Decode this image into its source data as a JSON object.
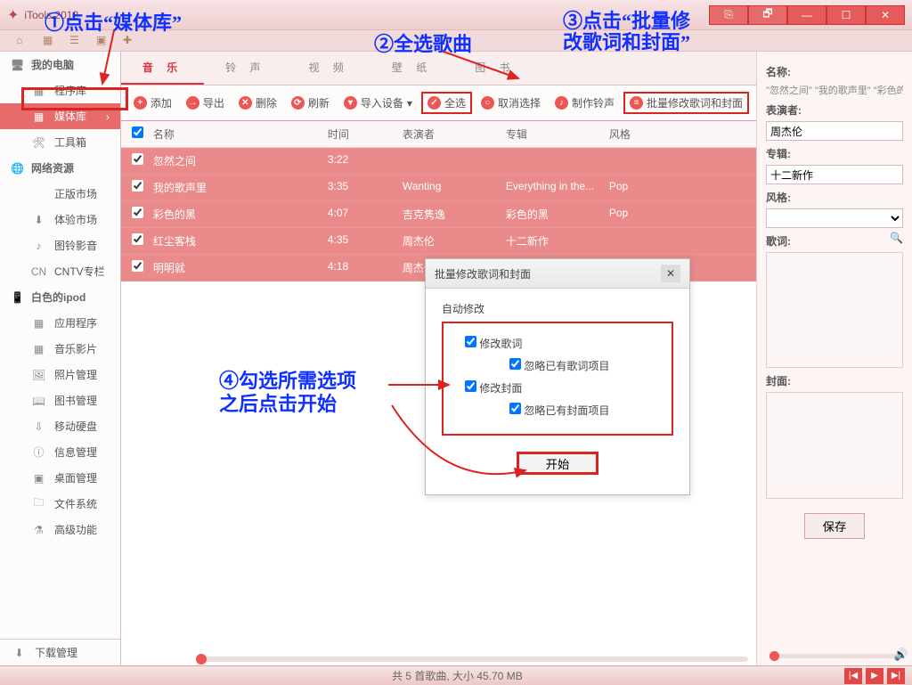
{
  "app": {
    "title": "iTools 2012"
  },
  "window_buttons": {
    "feedback": "⎘",
    "restore": "🗗",
    "min": "—",
    "max": "☐",
    "close": "✕"
  },
  "sidebar": {
    "sections": [
      {
        "title": "我的电脑",
        "icon": "🖥",
        "items": [
          {
            "icon": "▦",
            "label": "程序库"
          },
          {
            "icon": "▦",
            "label": "媒体库",
            "active": true
          },
          {
            "icon": "🛠",
            "label": "工具箱"
          }
        ]
      },
      {
        "title": "网络资源",
        "icon": "🌐",
        "items": [
          {
            "icon": "",
            "label": "正版市场"
          },
          {
            "icon": "⬇",
            "label": "体验市场"
          },
          {
            "icon": "♪",
            "label": "图铃影音"
          },
          {
            "icon": "CN",
            "label": "CNTV专栏"
          }
        ]
      },
      {
        "title": "白色的ipod",
        "icon": "📱",
        "items": [
          {
            "icon": "▦",
            "label": "应用程序"
          },
          {
            "icon": "▦",
            "label": "音乐影片"
          },
          {
            "icon": "🖼",
            "label": "照片管理"
          },
          {
            "icon": "📖",
            "label": "图书管理"
          },
          {
            "icon": "⇩",
            "label": "移动硬盘"
          },
          {
            "icon": "ⓘ",
            "label": "信息管理"
          },
          {
            "icon": "▣",
            "label": "桌面管理"
          },
          {
            "icon": "🗀",
            "label": "文件系统"
          },
          {
            "icon": "⚗",
            "label": "高级功能"
          }
        ]
      }
    ],
    "download_mgr": "下载管理"
  },
  "tabs": [
    "音 乐",
    "铃 声",
    "视 频",
    "壁 纸",
    "图 书"
  ],
  "active_tab": 0,
  "toolbar": {
    "add": "添加",
    "export": "导出",
    "delete": "删除",
    "refresh": "刷新",
    "import_device": "导入设备",
    "select_all": "全选",
    "deselect": "取消选择",
    "make_ring": "制作铃声",
    "batch": "批量修改歌词和封面"
  },
  "columns": {
    "name": "名称",
    "time": "时间",
    "artist": "表演者",
    "album": "专辑",
    "genre": "风格"
  },
  "rows": [
    {
      "name": "忽然之间",
      "time": "3:22",
      "artist": "",
      "album": "",
      "genre": ""
    },
    {
      "name": "我的歌声里",
      "time": "3:35",
      "artist": "Wanting",
      "album": "Everything in the...",
      "genre": "Pop"
    },
    {
      "name": "彩色的黑",
      "time": "4:07",
      "artist": "吉克隽逸",
      "album": "彩色的黑",
      "genre": "Pop"
    },
    {
      "name": "红尘客栈",
      "time": "4:35",
      "artist": "周杰伦",
      "album": "十二新作",
      "genre": ""
    },
    {
      "name": "明明就",
      "time": "4:18",
      "artist": "周杰伦",
      "album": "十二新作",
      "genre": ""
    }
  ],
  "dialog": {
    "title": "批量修改歌词和封面",
    "auto": "自动修改",
    "opt_lyric": "修改歌词",
    "opt_lyric_skip": "忽略已有歌词项目",
    "opt_cover": "修改封面",
    "opt_cover_skip": "忽略已有封面项目",
    "start": "开始"
  },
  "right": {
    "name_label": "名称:",
    "name_value": "\"忽然之间\" \"我的歌声里\" \"彩色的",
    "artist_label": "表演者:",
    "artist_value": "周杰伦",
    "album_label": "专辑:",
    "album_value": "十二新作",
    "genre_label": "风格:",
    "genre_value": "",
    "lyric_label": "歌词:",
    "cover_label": "封面:",
    "save": "保存"
  },
  "footer": {
    "status": "共 5 首歌曲, 大小 45.70 MB"
  },
  "annotations": {
    "a1": "①点击“媒体库”",
    "a2": "②全选歌曲",
    "a3a": "③点击“批量修",
    "a3b": "改歌词和封面”",
    "a4a": "④勾选所需选项",
    "a4b": "之后点击开始"
  }
}
